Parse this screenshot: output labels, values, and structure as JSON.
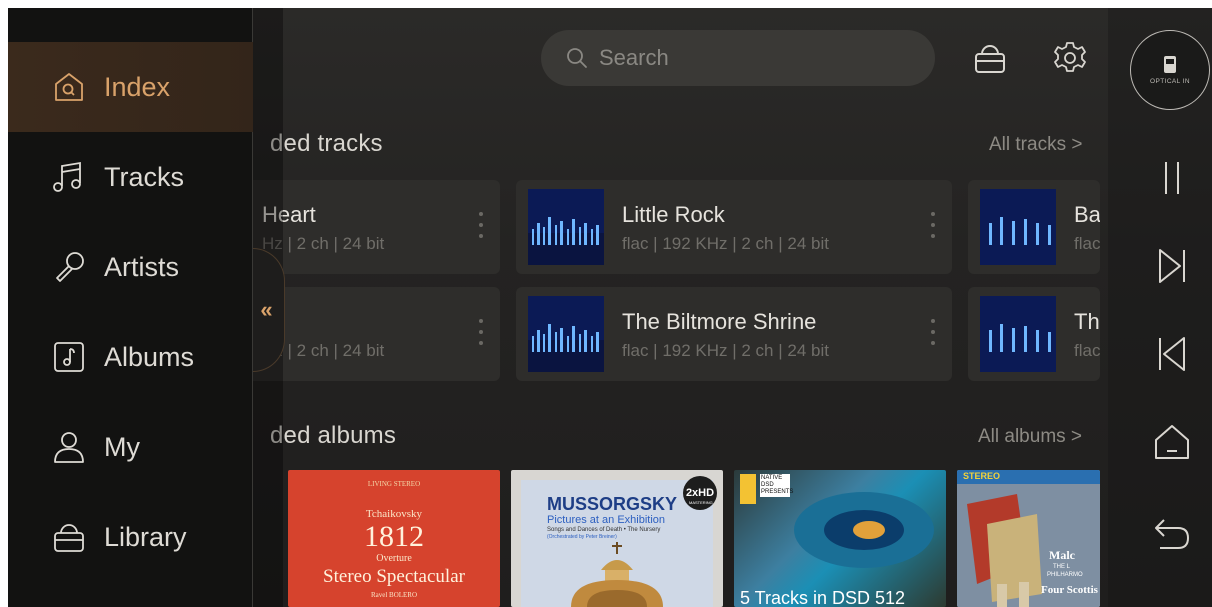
{
  "search": {
    "placeholder": "Search"
  },
  "sections": {
    "tracks": {
      "title": "Recently added tracks",
      "visible_title": "ded tracks",
      "link": "All tracks  >"
    },
    "albums": {
      "title": "Recently added albums",
      "visible_title": "ded albums",
      "link": "All albums  >"
    }
  },
  "tracks": [
    {
      "title": "Heart",
      "meta": "Hz | 2 ch | 24 bit"
    },
    {
      "title": "",
      "meta": "Hz | 2 ch | 24 bit"
    },
    {
      "title": "Little Rock",
      "meta": "flac | 192 KHz | 2 ch | 24 bit"
    },
    {
      "title": "The Biltmore Shrine",
      "meta": "flac | 192 KHz | 2 ch | 24 bit"
    },
    {
      "title": "Ba",
      "meta": "flac"
    },
    {
      "title": "Th",
      "meta": "flac"
    }
  ],
  "albums": [
    {
      "line1": "LIVING STEREO",
      "line2": "Tchaikovsky",
      "line3": "1812",
      "line4": "Overture",
      "line5": "Stereo Spectacular",
      "line6": "Ravel BOLERO"
    },
    {
      "badge": "2xHD",
      "badge_sub": "MASTERING",
      "title": "MUSSORGSKY",
      "subtitle": "Pictures at an Exhibition",
      "note": "Songs and Dances of Death • The Nursery",
      "note2": "(Orchestrated by Peter Breiner)"
    },
    {
      "badge": "NATIVE DSD PRESENTS",
      "caption": "5 Tracks in DSD 512"
    },
    {
      "tag": "STEREO",
      "text1": "Malc",
      "text2": "THE L",
      "text3": "PHILHARMO",
      "text4": "Four Scottis"
    }
  ],
  "drawer": {
    "items": [
      {
        "label": "Index",
        "icon": "index-icon",
        "active": true
      },
      {
        "label": "Tracks",
        "icon": "music-note-icon",
        "active": false
      },
      {
        "label": "Artists",
        "icon": "microphone-icon",
        "active": false
      },
      {
        "label": "Albums",
        "icon": "album-icon",
        "active": false
      },
      {
        "label": "My",
        "icon": "user-icon",
        "active": false
      },
      {
        "label": "Library",
        "icon": "library-icon",
        "active": false
      }
    ],
    "collapse_glyph": "«"
  },
  "rail": {
    "input_label": "OPTICAL IN"
  },
  "colors": {
    "accent": "#d9a26a",
    "active_bg": "#3b2a1c",
    "text": "#dedbd5",
    "muted": "#706e69"
  }
}
